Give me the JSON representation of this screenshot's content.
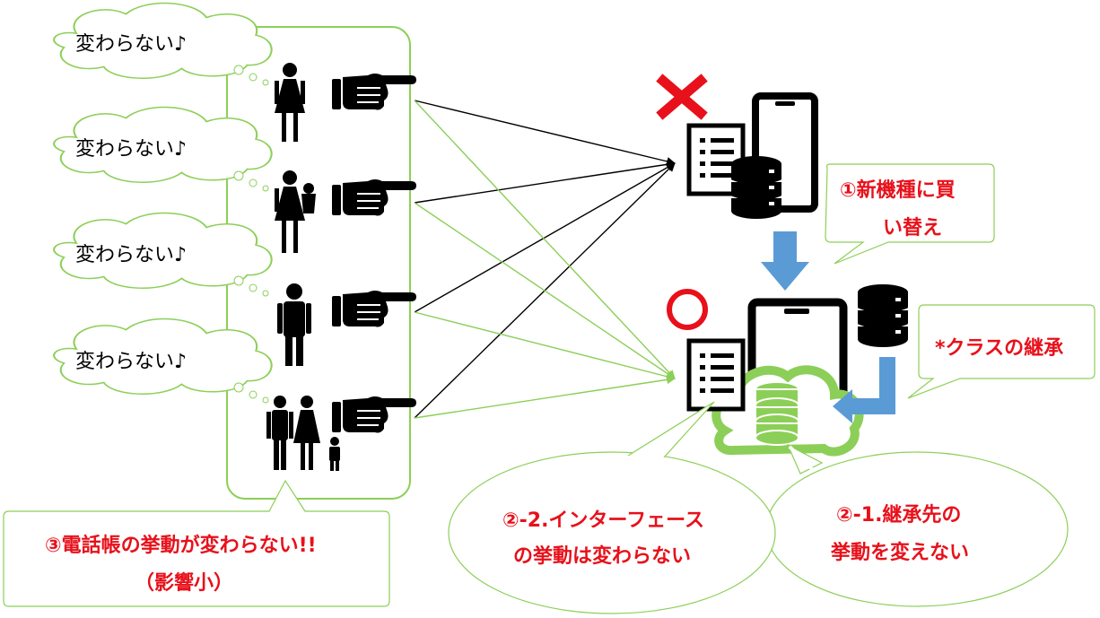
{
  "users": {
    "speech": [
      "変わらない♪",
      "変わらない♪",
      "変わらない♪",
      "変わらない♪"
    ]
  },
  "callouts": {
    "new_model": [
      "①新機種に買",
      "い替え"
    ],
    "class_inheritance": "*クラスの継承",
    "phonebook_line1": "③電話帳の挙動が変わらない!!",
    "phonebook_line2": "（影響小）",
    "interface_line1": "②-2.インターフェース",
    "interface_line2": "の挙動は変わらない",
    "inherit_line1": "②-1.継承先の",
    "inherit_line2": "挙動を変えない"
  },
  "colors": {
    "accent_red": "#e8101a",
    "green": "#8ccf58",
    "blue": "#5b9bd5",
    "black": "#000000"
  },
  "marks": {
    "old_device": "cross-mark-icon",
    "new_device": "circle-mark-icon"
  }
}
